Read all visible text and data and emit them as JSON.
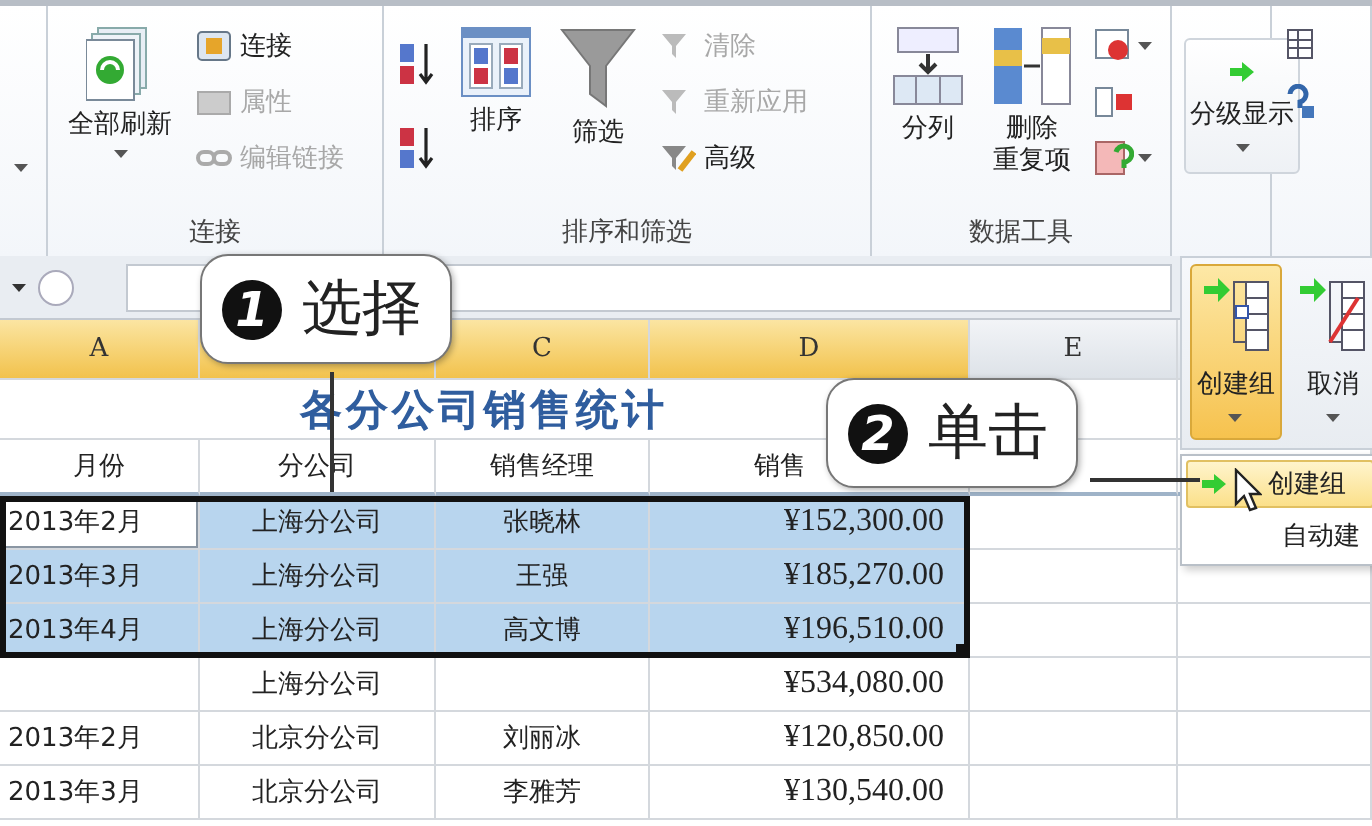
{
  "ribbon": {
    "groups": [
      {
        "controls": [
          {
            "kind": "icon",
            "dropdown": true
          }
        ]
      },
      {
        "label": "连接",
        "controls": [
          {
            "kind": "large",
            "label": "全部刷新",
            "dropdown": true
          },
          {
            "kind": "small",
            "label": "连接",
            "disabled": false
          },
          {
            "kind": "small",
            "label": "属性",
            "disabled": true
          },
          {
            "kind": "small",
            "label": "编辑链接",
            "disabled": true
          }
        ]
      },
      {
        "label": "排序和筛选",
        "controls": [
          {
            "kind": "icon",
            "dropdown": false
          },
          {
            "kind": "icon",
            "dropdown": false
          },
          {
            "kind": "large",
            "label": "排序",
            "dropdown": false
          },
          {
            "kind": "large",
            "label": "筛选",
            "dropdown": false
          },
          {
            "kind": "small",
            "label": "清除",
            "disabled": true
          },
          {
            "kind": "small",
            "label": "重新应用",
            "disabled": true
          },
          {
            "kind": "small",
            "label": "高级",
            "disabled": false
          }
        ]
      },
      {
        "label": "数据工具",
        "controls": [
          {
            "kind": "large",
            "label": "分列",
            "dropdown": false
          },
          {
            "kind": "large",
            "label": [
              "删除",
              "重复项"
            ],
            "dropdown": false
          },
          {
            "kind": "icon",
            "dropdown": true
          },
          {
            "kind": "icon",
            "dropdown": false
          },
          {
            "kind": "icon",
            "dropdown": true
          }
        ]
      },
      {
        "controls": [
          {
            "kind": "boxed",
            "label": "分级显示",
            "dropdown": true
          }
        ]
      },
      {
        "controls": [
          {
            "kind": "icon",
            "dropdown": false
          },
          {
            "kind": "icon",
            "dropdown": false
          }
        ]
      }
    ]
  },
  "sheet": {
    "columns": [
      {
        "label": "A",
        "selected": true
      },
      {
        "selected": true
      },
      {
        "label": "C",
        "selected": true
      },
      {
        "label": "D",
        "selected": true
      },
      {
        "label": "E",
        "selected": false
      }
    ],
    "rows": [
      {
        "kind": "title",
        "text": "各分公司销售统计"
      },
      {
        "kind": "header",
        "cells": [
          "月份",
          "分公司",
          "销售经理",
          "销售"
        ]
      },
      {
        "kind": "data",
        "selected": true,
        "cells": [
          {
            "text": "2013年2月",
            "active": true
          },
          {
            "text": "上海分公司",
            "active": false
          },
          {
            "text": "张晓林",
            "active": false
          },
          {
            "text": "¥152,300.00",
            "active": false
          }
        ]
      },
      {
        "kind": "data",
        "selected": true,
        "cells": [
          {
            "text": "2013年3月",
            "active": false
          },
          {
            "text": "上海分公司",
            "active": false
          },
          {
            "text": "王强",
            "active": false
          },
          {
            "text": "¥185,270.00",
            "active": false
          }
        ]
      },
      {
        "kind": "data",
        "selected": true,
        "cells": [
          {
            "text": "2013年4月",
            "active": false
          },
          {
            "text": "上海分公司",
            "active": false
          },
          {
            "text": "高文博",
            "active": false
          },
          {
            "text": "¥196,510.00",
            "active": false
          }
        ]
      },
      {
        "kind": "data",
        "selected": false,
        "cells": [
          null,
          {
            "text": "上海分公司",
            "active": false
          },
          null,
          {
            "text": "¥534,080.00",
            "active": false
          }
        ]
      },
      {
        "kind": "data",
        "selected": false,
        "cells": [
          {
            "text": "2013年2月",
            "active": false
          },
          {
            "text": "北京分公司",
            "active": false
          },
          {
            "text": "刘丽冰",
            "active": false
          },
          {
            "text": "¥120,850.00",
            "active": false
          }
        ]
      },
      {
        "kind": "data",
        "selected": false,
        "cells": [
          {
            "text": "2013年3月",
            "active": false
          },
          {
            "text": "北京分公司",
            "active": false
          },
          {
            "text": "李雅芳",
            "active": false
          },
          {
            "text": "¥130,540.00",
            "active": false
          }
        ]
      }
    ]
  },
  "outline_panel": {
    "buttons": [
      {
        "label": "创建组",
        "selected": true
      },
      {
        "label": "取消",
        "selected": false
      }
    ],
    "menu": [
      {
        "label": "创建组",
        "selected": true
      },
      {
        "label": "自动建",
        "selected": false
      }
    ]
  },
  "callouts": [
    {
      "number": "1",
      "text": "选择"
    },
    {
      "number": "2",
      "text": "单击"
    }
  ]
}
